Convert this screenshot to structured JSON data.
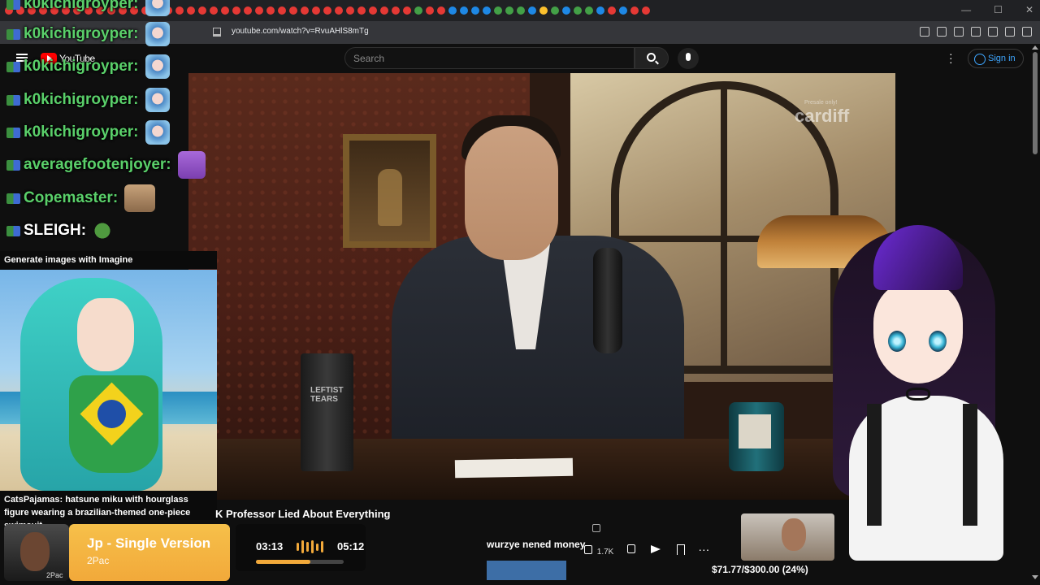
{
  "browser": {
    "url": "youtube.com/watch?v=RvuAHlS8mTg"
  },
  "youtube": {
    "logo_text": "YouTube",
    "search_placeholder": "Search",
    "sign_in": "Sign in"
  },
  "video": {
    "mug_text": "LEFTIST\nTEARS",
    "watermark": "cardiff",
    "watermark_small": "Presale only!",
    "lower_title": "K Professor Lied About Everything"
  },
  "chat": {
    "messages": [
      {
        "user": "k0kichigroyper:",
        "emote": "miku"
      },
      {
        "user": "k0kichigroyper:",
        "emote": "miku"
      },
      {
        "user": "k0kichigroyper:",
        "emote": "miku"
      },
      {
        "user": "k0kichigroyper:",
        "emote": "miku"
      },
      {
        "user": "averagefootenjoyer:",
        "emote": "purple-emote"
      },
      {
        "user": "Copemaster:",
        "emote": "doge-emote"
      },
      {
        "user": "SLEIGH:",
        "emote": "frog-emote"
      }
    ],
    "colors": {
      "k0kichigroyper:": "#5ad06a",
      "averagefootenjoyer:": "#5ad06a",
      "Copemaster:": "#5ad06a",
      "SLEIGH:": "#ffffff"
    }
  },
  "imagine": {
    "title": "Generate images with Imagine",
    "caption": "CatsPajamas: hatsune miku with hourglass figure wearing a brazilian-themed one-piece swimsuit..."
  },
  "now_playing": {
    "track": "Jp - Single Version",
    "artist": "2Pac",
    "art_label": "2Pac",
    "current": "03:13",
    "duration": "05:12",
    "progress": 0.62
  },
  "comment": {
    "text": "wurzye nened money"
  },
  "actions": {
    "likes": "1.7K"
  },
  "goal": {
    "text": "$71.77/$300.00 (24%)",
    "fraction": 0.24
  }
}
